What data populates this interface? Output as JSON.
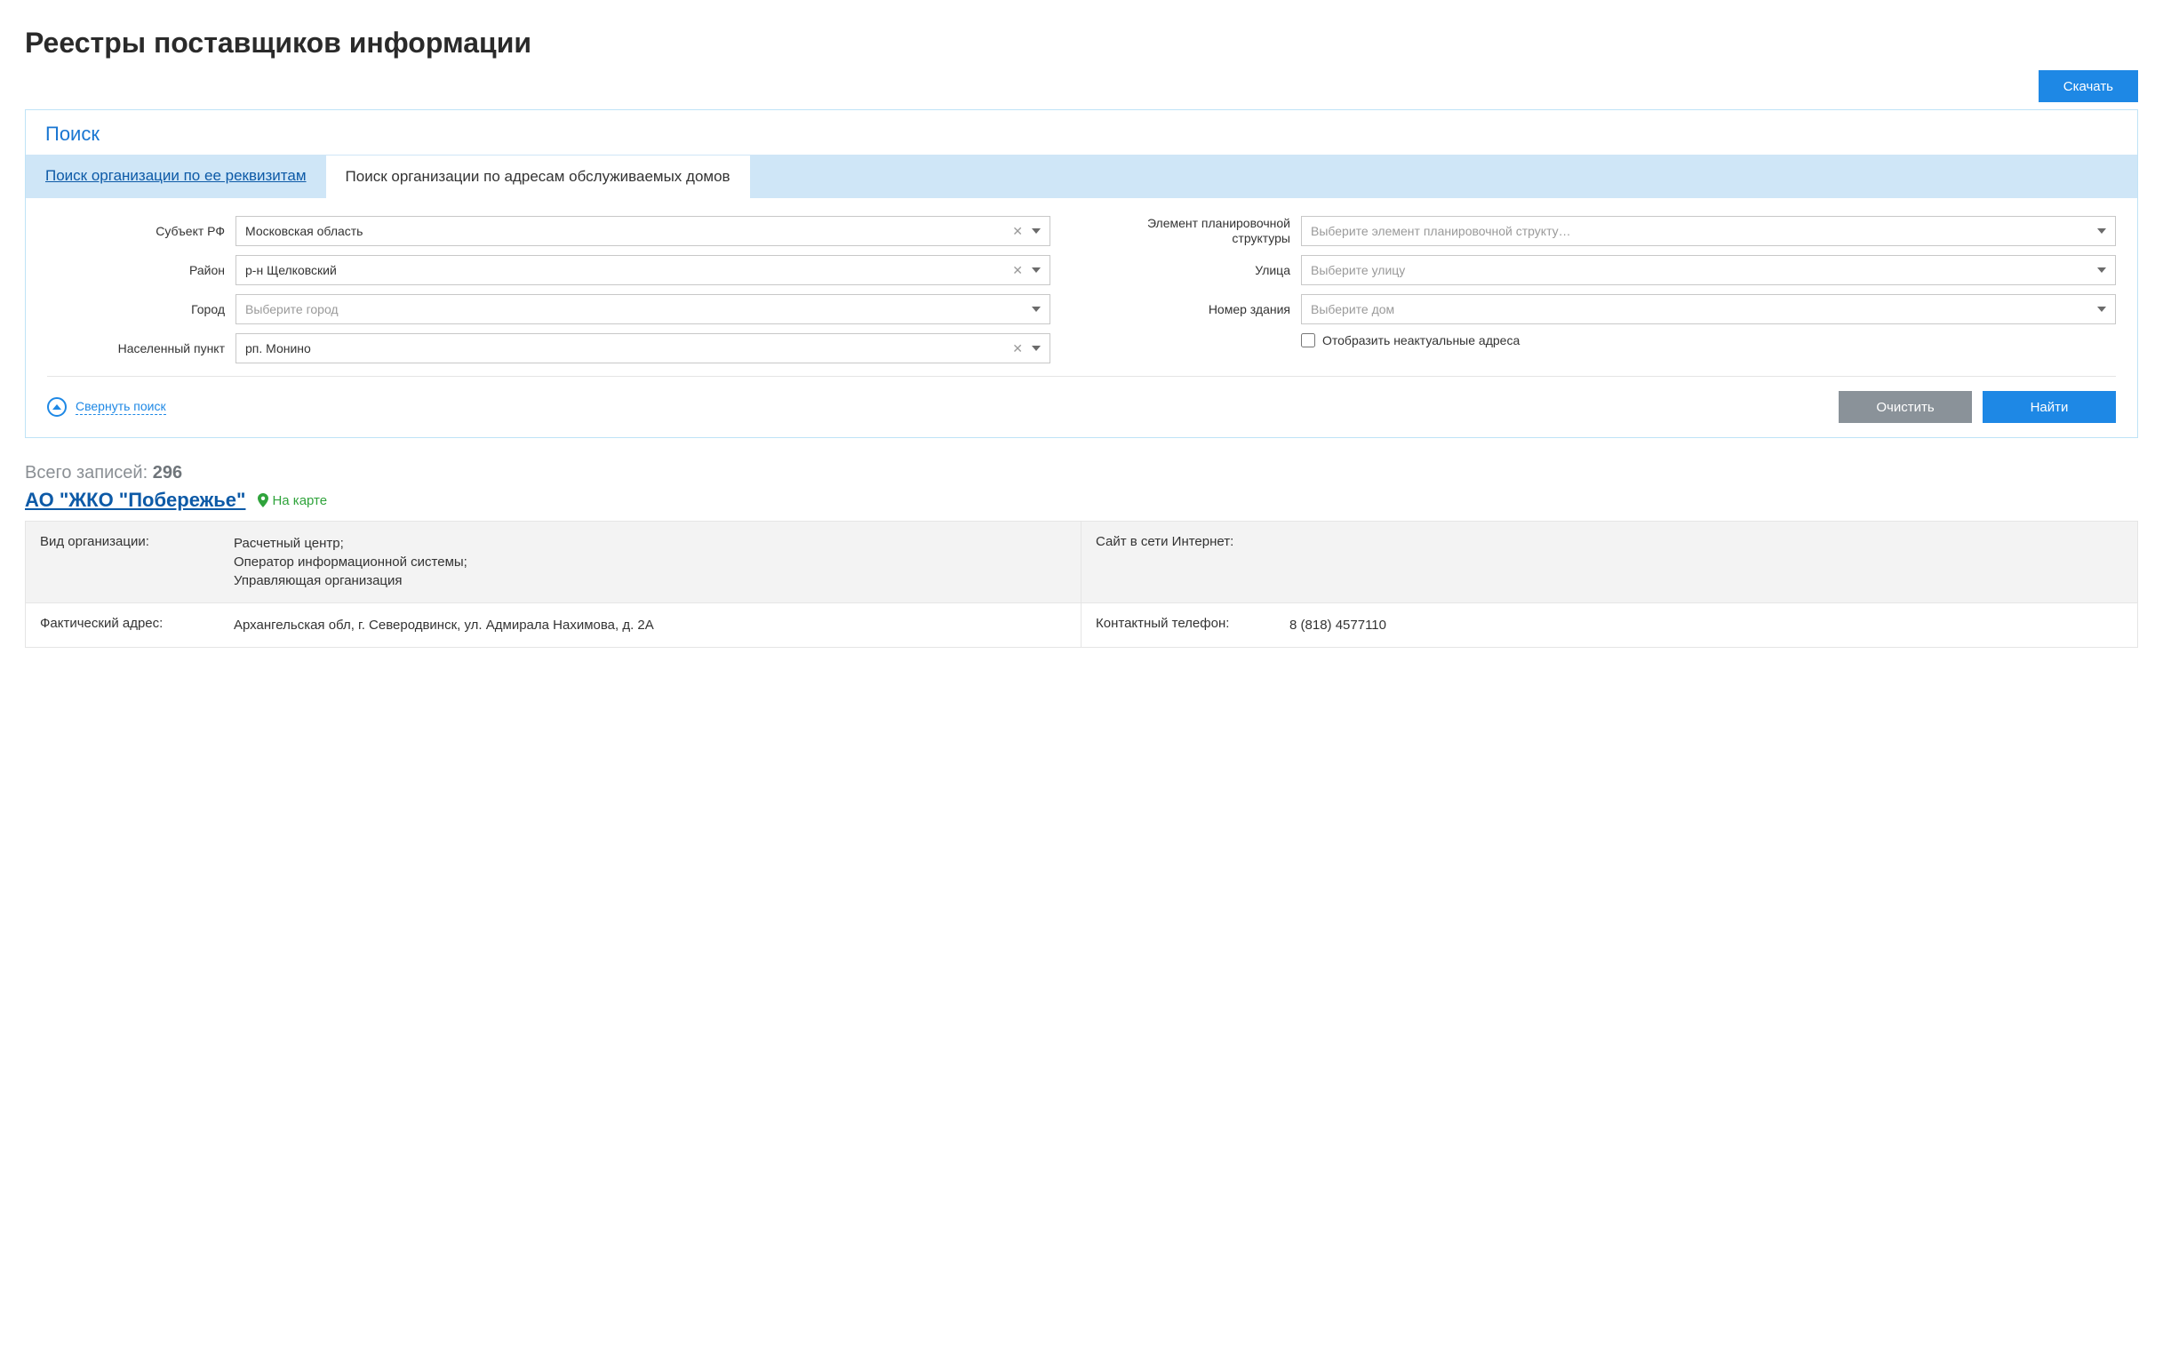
{
  "page_title": "Реестры поставщиков информации",
  "download_button": "Скачать",
  "search": {
    "header": "Поиск",
    "tabs": {
      "by_requisites": "Поиск организации по ее реквизитам",
      "by_address": "Поиск организации по адресам обслуживаемых домов"
    },
    "left": {
      "subject_label": "Субъект РФ",
      "subject_value": "Московская область",
      "district_label": "Район",
      "district_value": "р-н Щелковский",
      "city_label": "Город",
      "city_placeholder": "Выберите город",
      "settlement_label": "Населенный пункт",
      "settlement_value": "рп. Монино"
    },
    "right": {
      "planning_label": "Элемент планировочной структуры",
      "planning_placeholder": "Выберите элемент планировочной структу…",
      "street_label": "Улица",
      "street_placeholder": "Выберите улицу",
      "building_label": "Номер здания",
      "building_placeholder": "Выберите дом",
      "show_inactive_label": "Отобразить неактуальные адреса"
    },
    "collapse_label": "Свернуть поиск",
    "clear_button": "Очистить",
    "find_button": "Найти"
  },
  "results": {
    "total_label": "Всего записей:",
    "total_count": "296",
    "org_name": "АО \"ЖКО \"Побережье\"",
    "map_link": "На карте",
    "fields": {
      "org_type_label": "Вид организации:",
      "org_type_value": "Расчетный центр;\nОператор информационной системы;\nУправляющая организация",
      "website_label": "Сайт в сети Интернет:",
      "website_value": "",
      "address_label": "Фактический адрес:",
      "address_value": "Архангельская обл, г. Северодвинск, ул. Адмирала Нахимова, д. 2А",
      "phone_label": "Контактный телефон:",
      "phone_value": "8 (818) 4577110"
    }
  }
}
